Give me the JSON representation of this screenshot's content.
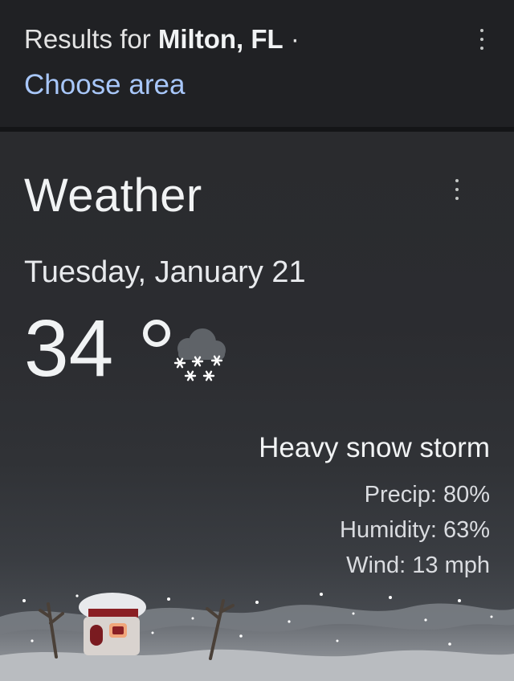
{
  "header": {
    "results_prefix": "Results for",
    "location": "Milton, FL",
    "separator": "·",
    "choose_area": "Choose area",
    "menu_icon": "more-vert-icon"
  },
  "weather": {
    "title": "Weather",
    "date": "Tuesday, January 21",
    "temperature": "34",
    "condition_icon": "snow-cloud-icon",
    "condition": "Heavy snow storm",
    "precip": "Precip: 80%",
    "humidity": "Humidity: 63%",
    "wind": "Wind: 13 mph",
    "menu_icon": "more-vert-icon",
    "scene": "snowy-igloo-illustration"
  }
}
